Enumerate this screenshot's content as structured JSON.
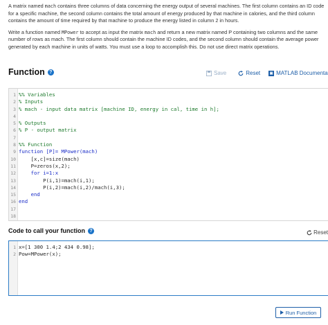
{
  "problem": {
    "p1_a": "A matrix named ",
    "p1_var": "mach",
    "p1_b": " contains three columns of data concerning the energy output of several machines. The first column contains an ID code for a specific machine, the second column contains the total amount of energy produced by that machine in calories, and the third column contains the amount of time required by that machine to produce the energy listed in column 2 in hours.",
    "p2_a": "Write a function named ",
    "p2_fn": "MPower",
    "p2_b": " to accept as input the matrix ",
    "p2_var": "mach",
    "p2_c": " and return a new matrix named P containing two columns and the same number of rows as mach. The first column should contain the machine ID codes, and the second column should contain the average power generated by each machine in units of watts. You must use a loop to accomplish this. Do not use direct matrix operations."
  },
  "function_section": {
    "title": "Function",
    "save_label": "Save",
    "reset_label": "Reset",
    "doc_label": "MATLAB Documentation"
  },
  "function_code": [
    {
      "n": "1",
      "text": "%% Variables",
      "cls": "c-comment"
    },
    {
      "n": "2",
      "text": "% Inputs",
      "cls": "c-comment"
    },
    {
      "n": "3",
      "text": "% mach - input data matrix [machine ID, energy in cal, time in h];",
      "cls": "c-comment"
    },
    {
      "n": "4",
      "text": "",
      "cls": ""
    },
    {
      "n": "5",
      "text": "% Outputs",
      "cls": "c-comment"
    },
    {
      "n": "6",
      "text": "% P - output matrix",
      "cls": "c-comment"
    },
    {
      "n": "7",
      "text": "",
      "cls": ""
    },
    {
      "n": "8",
      "text": "%% Function",
      "cls": "c-comment"
    },
    {
      "n": "9",
      "text": "function [P]= MPower(mach)",
      "cls": "c-keyword"
    },
    {
      "n": "10",
      "text": "    [x,c]=size(mach)",
      "cls": ""
    },
    {
      "n": "11",
      "text": "    P=zeros(x,2);",
      "cls": ""
    },
    {
      "n": "12",
      "text": "    for i=1:x",
      "cls": "c-keyword"
    },
    {
      "n": "13",
      "text": "        P(i,1)=mach(i,1);",
      "cls": ""
    },
    {
      "n": "14",
      "text": "        P(i,2)=mach(i,2)/mach(i,3);",
      "cls": ""
    },
    {
      "n": "15",
      "text": "    end",
      "cls": "c-keyword"
    },
    {
      "n": "16",
      "text": "end",
      "cls": "c-keyword"
    },
    {
      "n": "17",
      "text": "",
      "cls": ""
    },
    {
      "n": "18",
      "text": "",
      "cls": ""
    }
  ],
  "call_section": {
    "title": "Code to call your function",
    "reset_label": "Reset",
    "run_label": "Run Function"
  },
  "call_code": [
    {
      "n": "1",
      "text": "x=[1 300 1.4;2 434 0.98];",
      "cls": ""
    },
    {
      "n": "2",
      "text": "Pow=MPower(x);",
      "cls": ""
    }
  ],
  "colors": {
    "accent": "#1d5ea8",
    "comment": "#1d7a2c",
    "keyword": "#1a2cc7",
    "focus_border": "#2b7bc6"
  }
}
